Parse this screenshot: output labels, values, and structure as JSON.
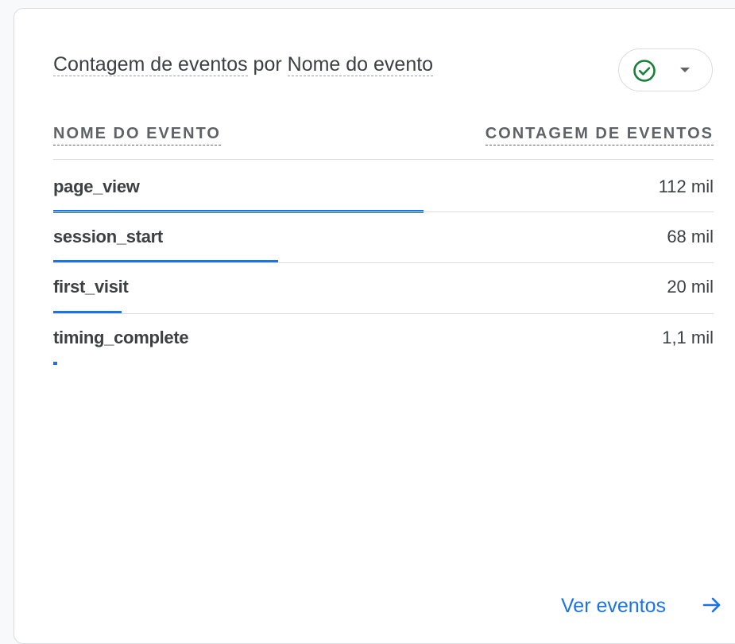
{
  "card": {
    "title_metric": "Contagem de eventos",
    "title_joiner": " por ",
    "title_dimension": "Nome do evento",
    "status_icon": "check-circle-icon",
    "status_color": "#188038",
    "dropdown_icon": "caret-down-icon"
  },
  "table": {
    "col_name": "NOME DO EVENTO",
    "col_count": "CONTAGEM DE EVENTOS",
    "bar_color": "#1a73e8",
    "rows": [
      {
        "name": "page_view",
        "value": "112 mil",
        "share": 1.0
      },
      {
        "name": "session_start",
        "value": "68 mil",
        "share": 0.607
      },
      {
        "name": "first_visit",
        "value": "20 mil",
        "share": 0.185
      },
      {
        "name": "timing_complete",
        "value": "1,1 mil",
        "share": 0.01
      }
    ]
  },
  "footer": {
    "link_label": "Ver eventos",
    "link_icon": "arrow-right-icon"
  }
}
